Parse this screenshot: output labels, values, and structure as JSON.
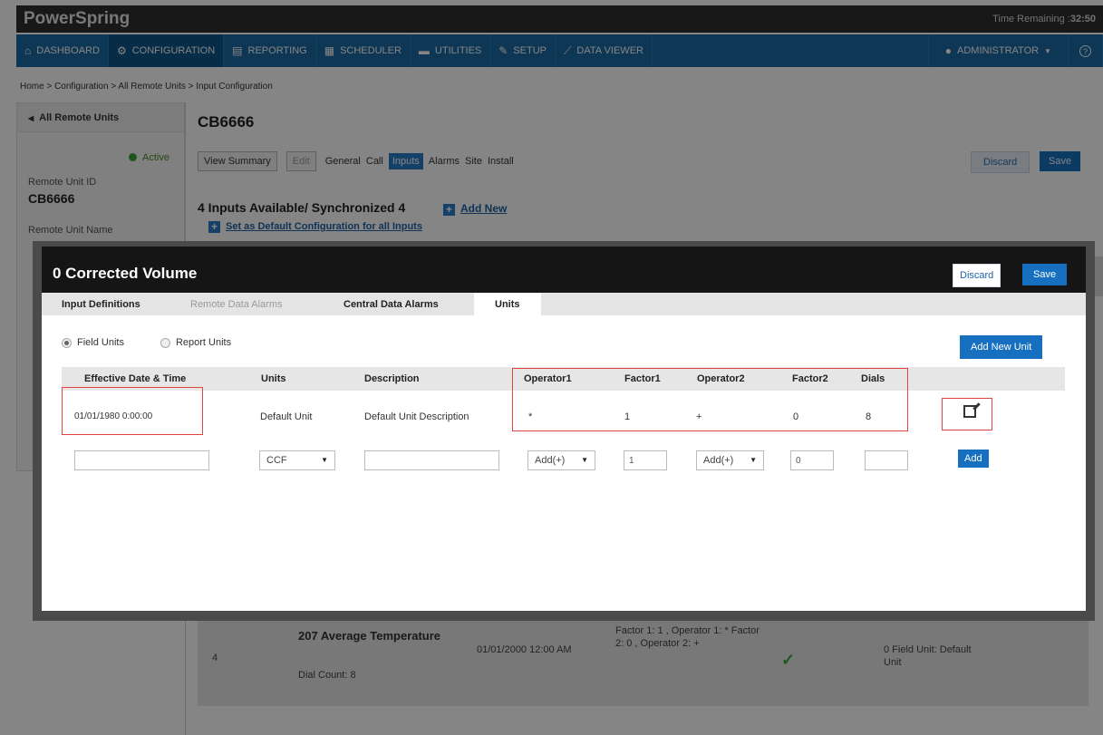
{
  "app": {
    "title": "PowerSpring",
    "timer_label": "Time Remaining :",
    "timer_value": "32:50"
  },
  "nav": {
    "items": [
      {
        "label": "DASHBOARD",
        "icon": "home-icon",
        "glyph": "⌂"
      },
      {
        "label": "CONFIGURATION",
        "icon": "gear-icon",
        "glyph": "⚙"
      },
      {
        "label": "REPORTING",
        "icon": "report-icon",
        "glyph": "▤"
      },
      {
        "label": "SCHEDULER",
        "icon": "calendar-icon",
        "glyph": "▦"
      },
      {
        "label": "UTILITIES",
        "icon": "toolbox-icon",
        "glyph": "▬"
      },
      {
        "label": "SETUP",
        "icon": "wrench-icon",
        "glyph": "✎"
      },
      {
        "label": "DATA VIEWER",
        "icon": "chart-icon",
        "glyph": "⟋"
      }
    ],
    "user": "ADMINISTRATOR",
    "help_glyph": "?"
  },
  "breadcrumb": "Home > Configuration > All Remote Units > Input Configuration",
  "left_panel": {
    "back_label": "All Remote Units",
    "status": "Active",
    "remote_id_label": "Remote Unit ID",
    "remote_id": "CB6666",
    "remote_name_label": "Remote Unit Name"
  },
  "unit": {
    "title": "CB6666",
    "buttons": {
      "view_summary": "View Summary",
      "edit": "Edit"
    },
    "tabs": [
      "General",
      "Call",
      "Inputs",
      "Alarms",
      "Site",
      "Install"
    ],
    "active_tab": "Inputs",
    "discard": "Discard",
    "save": "Save",
    "available_text": "4 Inputs Available/ Synchronized 4",
    "add_new": "Add New",
    "set_default": "Set as Default Configuration for all Inputs"
  },
  "bg_row": {
    "num": "4",
    "name": "207 Average Temperature",
    "dial": "Dial Count: 8",
    "date": "01/01/2000 12:00 AM",
    "factor": "Factor 1: 1 , Operator 1: * Factor 2: 0 , Operator 2: +",
    "field": "0 Field Unit: Default Unit"
  },
  "modal": {
    "title": "0 Corrected Volume",
    "discard": "Discard",
    "save": "Save",
    "tabs": {
      "input_definitions": "Input Definitions",
      "remote_alarms": "Remote Data Alarms",
      "central_alarms": "Central Data Alarms",
      "units": "Units"
    },
    "radio": {
      "field_units": "Field Units",
      "report_units": "Report Units"
    },
    "add_new_unit": "Add New Unit",
    "headers": {
      "effective": "Effective Date & Time",
      "units": "Units",
      "description": "Description",
      "operator1": "Operator1",
      "factor1": "Factor1",
      "operator2": "Operator2",
      "factor2": "Factor2",
      "dials": "Dials"
    },
    "row": {
      "effective": "01/01/1980 0:00:00",
      "units": "Default Unit",
      "description": "Default Unit Description",
      "operator1": "*",
      "factor1": "1",
      "operator2": "+",
      "factor2": "0",
      "dials": "8"
    },
    "new_row": {
      "units_select": "CCF",
      "operator1_select": "Add(+)",
      "factor1_value": "1",
      "operator2_select": "Add(+)",
      "factor2_value": "0",
      "add": "Add"
    }
  }
}
